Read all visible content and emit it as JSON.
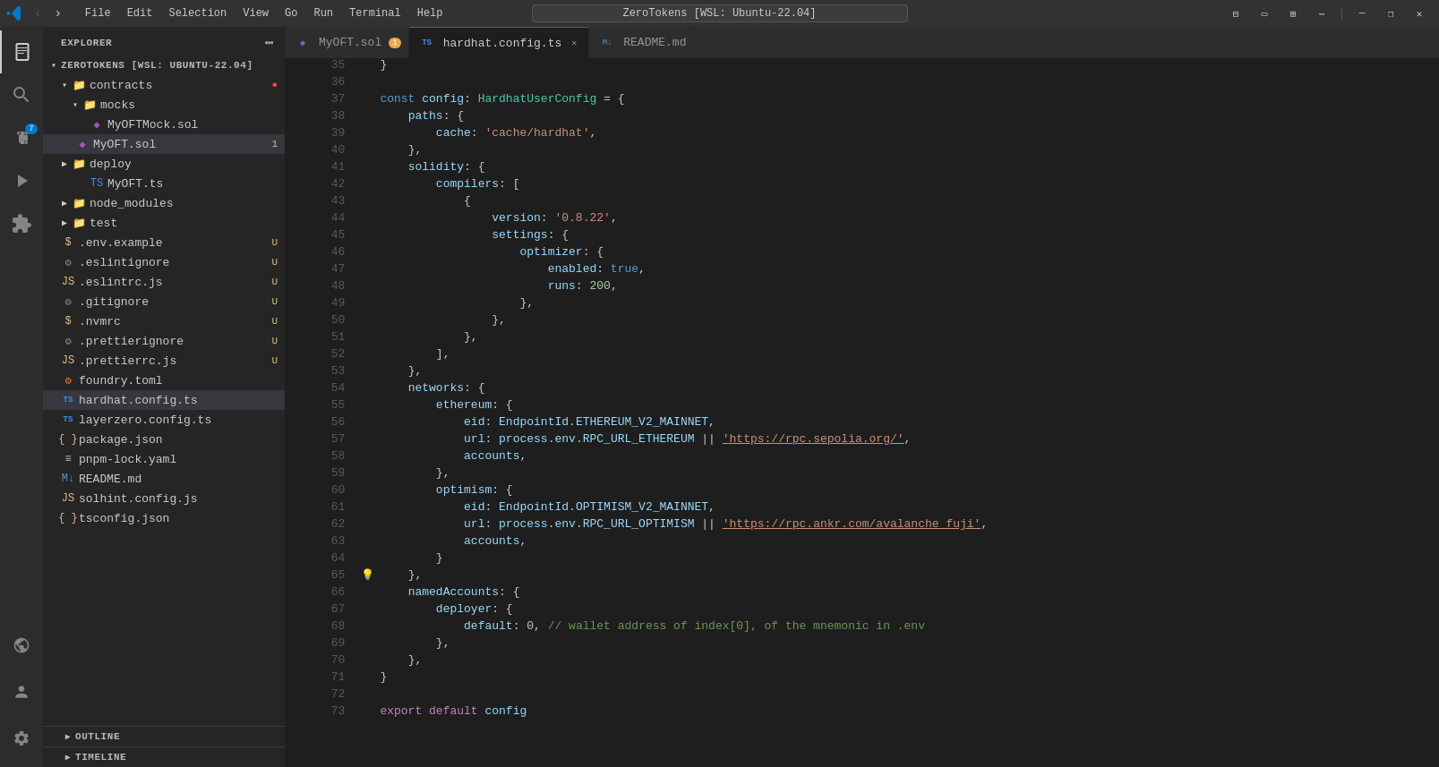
{
  "titlebar": {
    "menu_items": [
      "File",
      "Edit",
      "Selection",
      "View",
      "Go",
      "Run",
      "Terminal",
      "Help"
    ],
    "search_placeholder": "ZeroTokens [WSL: Ubuntu-22.04]",
    "window_controls": [
      "minimize",
      "restore",
      "maximize",
      "layout",
      "close"
    ]
  },
  "activity_bar": {
    "items": [
      {
        "name": "explorer",
        "icon": "⊞",
        "active": true
      },
      {
        "name": "search",
        "icon": "🔍"
      },
      {
        "name": "source-control",
        "icon": "⎇",
        "badge": "7"
      },
      {
        "name": "run-debug",
        "icon": "▷"
      },
      {
        "name": "extensions",
        "icon": "⊟"
      }
    ],
    "bottom_items": [
      {
        "name": "remote",
        "icon": "⬡"
      },
      {
        "name": "account",
        "icon": "◯"
      },
      {
        "name": "settings",
        "icon": "⚙"
      }
    ]
  },
  "sidebar": {
    "title": "EXPLORER",
    "workspace": "ZEROTOKENS [WSL: UBUNTU-22.04]",
    "tree": [
      {
        "indent": 0,
        "type": "folder",
        "arrow": "▾",
        "label": "contracts",
        "badge": "●",
        "badge_type": "red",
        "expanded": true
      },
      {
        "indent": 1,
        "type": "folder",
        "arrow": "▾",
        "label": "mocks",
        "expanded": true
      },
      {
        "indent": 2,
        "type": "sol",
        "label": "MyOFTMock.sol"
      },
      {
        "indent": 1,
        "type": "sol",
        "label": "MyOFT.sol",
        "badge": "1",
        "badge_type": "gold",
        "selected": true
      },
      {
        "indent": 0,
        "type": "folder",
        "arrow": "▶",
        "label": "deploy",
        "expanded": false
      },
      {
        "indent": 1,
        "type": "ts",
        "label": "MyOFT.ts"
      },
      {
        "indent": 0,
        "type": "folder",
        "arrow": "▶",
        "label": "node_modules",
        "expanded": false
      },
      {
        "indent": 0,
        "type": "folder",
        "arrow": "▶",
        "label": "test",
        "expanded": false
      },
      {
        "indent": 0,
        "type": "env",
        "label": ".env.example",
        "badge": "U",
        "badge_type": "gold"
      },
      {
        "indent": 0,
        "type": "git",
        "label": ".eslintignore",
        "badge": "U",
        "badge_type": "gold"
      },
      {
        "indent": 0,
        "type": "js",
        "label": ".eslintrc.js",
        "badge": "U",
        "badge_type": "gold"
      },
      {
        "indent": 0,
        "type": "git",
        "label": ".gitignore",
        "badge": "U",
        "badge_type": "gold"
      },
      {
        "indent": 0,
        "type": "env",
        "label": ".nvmrc",
        "badge": "U",
        "badge_type": "gold"
      },
      {
        "indent": 0,
        "type": "git",
        "label": ".prettierignore",
        "badge": "U",
        "badge_type": "gold"
      },
      {
        "indent": 0,
        "type": "js",
        "label": ".prettierrc.js",
        "badge": "U",
        "badge_type": "gold"
      },
      {
        "indent": 0,
        "type": "toml",
        "label": "foundry.toml"
      },
      {
        "indent": 0,
        "type": "ts",
        "label": "hardhat.config.ts",
        "active": true
      },
      {
        "indent": 0,
        "type": "ts",
        "label": "layerzero.config.ts"
      },
      {
        "indent": 0,
        "type": "json",
        "label": "package.json"
      },
      {
        "indent": 0,
        "type": "yaml",
        "label": "pnpm-lock.yaml"
      },
      {
        "indent": 0,
        "type": "md",
        "label": "README.md"
      },
      {
        "indent": 0,
        "type": "js",
        "label": "solhint.config.js"
      },
      {
        "indent": 0,
        "type": "json",
        "label": "tsconfig.json"
      }
    ],
    "outline_label": "OUTLINE",
    "timeline_label": "TIMELINE"
  },
  "tabs": [
    {
      "label": "MyOFT.sol",
      "type": "sol",
      "modified": false,
      "active": false,
      "number": "1"
    },
    {
      "label": "hardhat.config.ts",
      "type": "ts",
      "modified": false,
      "active": true,
      "closeable": true
    },
    {
      "label": "README.md",
      "type": "md",
      "modified": false,
      "active": false
    }
  ],
  "editor": {
    "filename": "hardhat.config.ts",
    "lines": [
      {
        "num": 35,
        "gutter": "",
        "content": [
          {
            "t": "punc",
            "v": "}"
          }
        ]
      },
      {
        "num": 36,
        "gutter": "",
        "content": []
      },
      {
        "num": 37,
        "gutter": "",
        "content": [
          {
            "t": "kw",
            "v": "const"
          },
          {
            "t": "op",
            "v": " "
          },
          {
            "t": "var",
            "v": "config"
          },
          {
            "t": "op",
            "v": ": "
          },
          {
            "t": "type",
            "v": "HardhatUserConfig"
          },
          {
            "t": "op",
            "v": " = {"
          }
        ]
      },
      {
        "num": 38,
        "gutter": "",
        "content": [
          {
            "t": "op",
            "v": "    "
          },
          {
            "t": "prop",
            "v": "paths"
          },
          {
            "t": "op",
            "v": ": {"
          }
        ]
      },
      {
        "num": 39,
        "gutter": "",
        "content": [
          {
            "t": "op",
            "v": "        "
          },
          {
            "t": "prop",
            "v": "cache"
          },
          {
            "t": "op",
            "v": ": "
          },
          {
            "t": "str",
            "v": "'cache/hardhat'"
          },
          {
            "t": "op",
            "v": ","
          }
        ]
      },
      {
        "num": 40,
        "gutter": "",
        "content": [
          {
            "t": "op",
            "v": "    "
          },
          {
            "t": "punc",
            "v": "},"
          }
        ]
      },
      {
        "num": 41,
        "gutter": "",
        "content": [
          {
            "t": "op",
            "v": "    "
          },
          {
            "t": "prop",
            "v": "solidity"
          },
          {
            "t": "op",
            "v": ": {"
          }
        ]
      },
      {
        "num": 42,
        "gutter": "",
        "content": [
          {
            "t": "op",
            "v": "        "
          },
          {
            "t": "prop",
            "v": "compilers"
          },
          {
            "t": "op",
            "v": ": ["
          }
        ]
      },
      {
        "num": 43,
        "gutter": "",
        "content": [
          {
            "t": "op",
            "v": "            "
          },
          {
            "t": "punc",
            "v": "{"
          }
        ]
      },
      {
        "num": 44,
        "gutter": "",
        "content": [
          {
            "t": "op",
            "v": "                "
          },
          {
            "t": "prop",
            "v": "version"
          },
          {
            "t": "op",
            "v": ": "
          },
          {
            "t": "str",
            "v": "'0.8.22'"
          },
          {
            "t": "op",
            "v": ","
          }
        ]
      },
      {
        "num": 45,
        "gutter": "",
        "content": [
          {
            "t": "op",
            "v": "                "
          },
          {
            "t": "prop",
            "v": "settings"
          },
          {
            "t": "op",
            "v": ": {"
          }
        ]
      },
      {
        "num": 46,
        "gutter": "",
        "content": [
          {
            "t": "op",
            "v": "                    "
          },
          {
            "t": "prop",
            "v": "optimizer"
          },
          {
            "t": "op",
            "v": ": {"
          }
        ]
      },
      {
        "num": 47,
        "gutter": "",
        "content": [
          {
            "t": "op",
            "v": "                        "
          },
          {
            "t": "prop",
            "v": "enabled"
          },
          {
            "t": "op",
            "v": ": "
          },
          {
            "t": "bool",
            "v": "true"
          },
          {
            "t": "op",
            "v": ","
          }
        ]
      },
      {
        "num": 48,
        "gutter": "",
        "content": [
          {
            "t": "op",
            "v": "                        "
          },
          {
            "t": "prop",
            "v": "runs"
          },
          {
            "t": "op",
            "v": ": "
          },
          {
            "t": "num",
            "v": "200"
          },
          {
            "t": "op",
            "v": ","
          }
        ]
      },
      {
        "num": 49,
        "gutter": "",
        "content": [
          {
            "t": "op",
            "v": "                    "
          },
          {
            "t": "punc",
            "v": "},"
          }
        ]
      },
      {
        "num": 50,
        "gutter": "",
        "content": [
          {
            "t": "op",
            "v": "                "
          },
          {
            "t": "punc",
            "v": "},"
          }
        ]
      },
      {
        "num": 51,
        "gutter": "",
        "content": [
          {
            "t": "op",
            "v": "            "
          },
          {
            "t": "punc",
            "v": "},"
          }
        ]
      },
      {
        "num": 52,
        "gutter": "",
        "content": [
          {
            "t": "op",
            "v": "        "
          },
          {
            "t": "punc",
            "v": "],"
          }
        ]
      },
      {
        "num": 53,
        "gutter": "",
        "content": [
          {
            "t": "op",
            "v": "    "
          },
          {
            "t": "punc",
            "v": "},"
          }
        ]
      },
      {
        "num": 54,
        "gutter": "",
        "content": [
          {
            "t": "op",
            "v": "    "
          },
          {
            "t": "prop",
            "v": "networks"
          },
          {
            "t": "op",
            "v": ": {"
          }
        ]
      },
      {
        "num": 55,
        "gutter": "",
        "content": [
          {
            "t": "op",
            "v": "        "
          },
          {
            "t": "prop",
            "v": "ethereum"
          },
          {
            "t": "op",
            "v": ": {"
          }
        ]
      },
      {
        "num": 56,
        "gutter": "",
        "content": [
          {
            "t": "op",
            "v": "            "
          },
          {
            "t": "prop",
            "v": "eid"
          },
          {
            "t": "op",
            "v": ": "
          },
          {
            "t": "var",
            "v": "EndpointId"
          },
          {
            "t": "op",
            "v": "."
          },
          {
            "t": "var",
            "v": "ETHEREUM_V2_MAINNET"
          },
          {
            "t": "op",
            "v": ","
          }
        ]
      },
      {
        "num": 57,
        "gutter": "",
        "content": [
          {
            "t": "op",
            "v": "            "
          },
          {
            "t": "prop",
            "v": "url"
          },
          {
            "t": "op",
            "v": ": "
          },
          {
            "t": "var",
            "v": "process"
          },
          {
            "t": "op",
            "v": "."
          },
          {
            "t": "var",
            "v": "env"
          },
          {
            "t": "op",
            "v": "."
          },
          {
            "t": "var",
            "v": "RPC_URL_ETHEREUM"
          },
          {
            "t": "op",
            "v": " || "
          },
          {
            "t": "str2",
            "v": "'https://rpc.sepolia.org/'"
          },
          {
            "t": "op",
            "v": ","
          }
        ]
      },
      {
        "num": 58,
        "gutter": "",
        "content": [
          {
            "t": "op",
            "v": "            "
          },
          {
            "t": "prop",
            "v": "accounts"
          },
          {
            "t": "op",
            "v": ","
          }
        ]
      },
      {
        "num": 59,
        "gutter": "",
        "content": [
          {
            "t": "op",
            "v": "        "
          },
          {
            "t": "punc",
            "v": "},"
          }
        ]
      },
      {
        "num": 60,
        "gutter": "",
        "content": [
          {
            "t": "op",
            "v": "        "
          },
          {
            "t": "prop",
            "v": "optimism"
          },
          {
            "t": "op",
            "v": ": {"
          }
        ]
      },
      {
        "num": 61,
        "gutter": "",
        "content": [
          {
            "t": "op",
            "v": "            "
          },
          {
            "t": "prop",
            "v": "eid"
          },
          {
            "t": "op",
            "v": ": "
          },
          {
            "t": "var",
            "v": "EndpointId"
          },
          {
            "t": "op",
            "v": "."
          },
          {
            "t": "var",
            "v": "OPTIMISM_V2_MAINNET"
          },
          {
            "t": "op",
            "v": ","
          }
        ]
      },
      {
        "num": 62,
        "gutter": "",
        "content": [
          {
            "t": "op",
            "v": "            "
          },
          {
            "t": "prop",
            "v": "url"
          },
          {
            "t": "op",
            "v": ": "
          },
          {
            "t": "var",
            "v": "process"
          },
          {
            "t": "op",
            "v": "."
          },
          {
            "t": "var",
            "v": "env"
          },
          {
            "t": "op",
            "v": "."
          },
          {
            "t": "var",
            "v": "RPC_URL_OPTIMISM"
          },
          {
            "t": "op",
            "v": " || "
          },
          {
            "t": "str2",
            "v": "'https://rpc.ankr.com/avalanche_fuji'"
          },
          {
            "t": "op",
            "v": ","
          }
        ]
      },
      {
        "num": 63,
        "gutter": "",
        "content": [
          {
            "t": "op",
            "v": "            "
          },
          {
            "t": "prop",
            "v": "accounts"
          },
          {
            "t": "op",
            "v": ","
          }
        ]
      },
      {
        "num": 64,
        "gutter": "",
        "content": [
          {
            "t": "op",
            "v": "        "
          },
          {
            "t": "punc",
            "v": "}"
          }
        ]
      },
      {
        "num": 65,
        "gutter": "💡",
        "content": [
          {
            "t": "op",
            "v": "    "
          },
          {
            "t": "punc",
            "v": "},"
          }
        ]
      },
      {
        "num": 66,
        "gutter": "",
        "content": [
          {
            "t": "op",
            "v": "    "
          },
          {
            "t": "prop",
            "v": "namedAccounts"
          },
          {
            "t": "op",
            "v": ": {"
          }
        ]
      },
      {
        "num": 67,
        "gutter": "",
        "content": [
          {
            "t": "op",
            "v": "        "
          },
          {
            "t": "prop",
            "v": "deployer"
          },
          {
            "t": "op",
            "v": ": {"
          }
        ]
      },
      {
        "num": 68,
        "gutter": "",
        "content": [
          {
            "t": "op",
            "v": "            "
          },
          {
            "t": "prop",
            "v": "default"
          },
          {
            "t": "op",
            "v": ": "
          },
          {
            "t": "num",
            "v": "0"
          },
          {
            "t": "op",
            "v": ", "
          },
          {
            "t": "comment",
            "v": "// wallet address of index[0], of the mnemonic in .env"
          }
        ]
      },
      {
        "num": 69,
        "gutter": "",
        "content": [
          {
            "t": "op",
            "v": "        "
          },
          {
            "t": "punc",
            "v": "},"
          }
        ]
      },
      {
        "num": 70,
        "gutter": "",
        "content": [
          {
            "t": "op",
            "v": "    "
          },
          {
            "t": "punc",
            "v": "},"
          }
        ]
      },
      {
        "num": 71,
        "gutter": "",
        "content": [
          {
            "t": "punc",
            "v": "}"
          }
        ]
      },
      {
        "num": 72,
        "gutter": "",
        "content": []
      },
      {
        "num": 73,
        "gutter": "",
        "content": [
          {
            "t": "kw2",
            "v": "export"
          },
          {
            "t": "op",
            "v": " "
          },
          {
            "t": "kw2",
            "v": "default"
          },
          {
            "t": "op",
            "v": " "
          },
          {
            "t": "var",
            "v": "config"
          }
        ]
      }
    ]
  }
}
